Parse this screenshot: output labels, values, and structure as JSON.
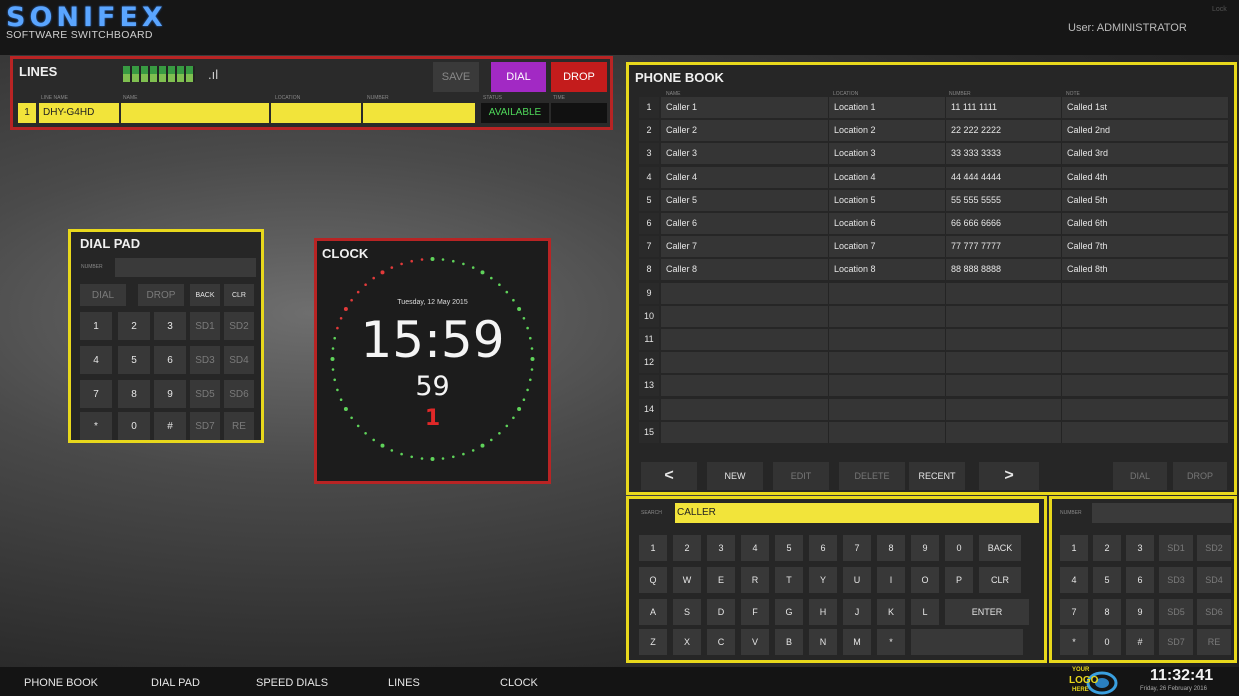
{
  "header": {
    "logo": "SONIFEX",
    "subtitle": "SOFTWARE SWITCHBOARD",
    "user": "User: ADMINISTRATOR",
    "user_tag": "Lock"
  },
  "lines": {
    "title": "LINES",
    "save_label": "SAVE",
    "dial_label": "DIAL",
    "drop_label": "DROP",
    "col_headers": [
      "LINE NAME",
      "NAME",
      "LOCATION",
      "NUMBER",
      "STATUS",
      "TIME"
    ],
    "row": {
      "index": "1",
      "name": "DHY-G4HD",
      "status": "AVAILABLE"
    }
  },
  "dialpad": {
    "title": "DIAL PAD",
    "number_label": "NUMBER",
    "top_keys": [
      "DIAL",
      "DROP",
      "BACK",
      "CLR"
    ],
    "keys": [
      [
        "1",
        "2",
        "3",
        "SD1",
        "SD2"
      ],
      [
        "4",
        "5",
        "6",
        "SD3",
        "SD4"
      ],
      [
        "7",
        "8",
        "9",
        "SD5",
        "SD6"
      ],
      [
        "*",
        "0",
        "#",
        "SD7",
        "RE"
      ]
    ]
  },
  "clock": {
    "title": "CLOCK",
    "date": "Tuesday, 12 May 2015",
    "time": "15:59",
    "seconds": "59",
    "red_digit": "1"
  },
  "phonebook": {
    "title": "PHONE BOOK",
    "col_headers": [
      "NAME",
      "LOCATION",
      "NUMBER",
      "NOTE"
    ],
    "rows": [
      {
        "idx": "1",
        "name": "Caller 1",
        "location": "Location 1",
        "number": "11 111 1111",
        "note": "Called 1st"
      },
      {
        "idx": "2",
        "name": "Caller 2",
        "location": "Location 2",
        "number": "22 222 2222",
        "note": "Called 2nd"
      },
      {
        "idx": "3",
        "name": "Caller 3",
        "location": "Location 3",
        "number": "33 333 3333",
        "note": "Called 3rd"
      },
      {
        "idx": "4",
        "name": "Caller 4",
        "location": "Location 4",
        "number": "44 444 4444",
        "note": "Called 4th"
      },
      {
        "idx": "5",
        "name": "Caller 5",
        "location": "Location 5",
        "number": "55 555 5555",
        "note": "Called 5th"
      },
      {
        "idx": "6",
        "name": "Caller 6",
        "location": "Location 6",
        "number": "66 666 6666",
        "note": "Called 6th"
      },
      {
        "idx": "7",
        "name": "Caller 7",
        "location": "Location 7",
        "number": "77 777 7777",
        "note": "Called 7th"
      },
      {
        "idx": "8",
        "name": "Caller 8",
        "location": "Location 8",
        "number": "88 888 8888",
        "note": "Called 8th"
      },
      {
        "idx": "9",
        "name": "",
        "location": "",
        "number": "",
        "note": ""
      },
      {
        "idx": "10",
        "name": "",
        "location": "",
        "number": "",
        "note": ""
      },
      {
        "idx": "11",
        "name": "",
        "location": "",
        "number": "",
        "note": ""
      },
      {
        "idx": "12",
        "name": "",
        "location": "",
        "number": "",
        "note": ""
      },
      {
        "idx": "13",
        "name": "",
        "location": "",
        "number": "",
        "note": ""
      },
      {
        "idx": "14",
        "name": "",
        "location": "",
        "number": "",
        "note": ""
      },
      {
        "idx": "15",
        "name": "",
        "location": "",
        "number": "",
        "note": ""
      }
    ],
    "buttons": {
      "prev": "<",
      "new": "NEW",
      "edit": "EDIT",
      "delete": "DELETE",
      "recent": "RECENT",
      "next": ">",
      "dial": "DIAL",
      "drop": "DROP"
    }
  },
  "keyboard": {
    "search_label": "SEARCH",
    "search_value": "CALLER",
    "rows": [
      [
        "1",
        "2",
        "3",
        "4",
        "5",
        "6",
        "7",
        "8",
        "9",
        "0",
        "BACK"
      ],
      [
        "Q",
        "W",
        "E",
        "R",
        "T",
        "Y",
        "U",
        "I",
        "O",
        "P",
        "CLR"
      ],
      [
        "A",
        "S",
        "D",
        "F",
        "G",
        "H",
        "J",
        "K",
        "L",
        "ENTER"
      ],
      [
        "Z",
        "X",
        "C",
        "V",
        "B",
        "N",
        "M",
        "*",
        ""
      ]
    ]
  },
  "speedpad": {
    "number_label": "NUMBER",
    "keys": [
      [
        "1",
        "2",
        "3",
        "SD1",
        "SD2"
      ],
      [
        "4",
        "5",
        "6",
        "SD3",
        "SD4"
      ],
      [
        "7",
        "8",
        "9",
        "SD5",
        "SD6"
      ],
      [
        "*",
        "0",
        "#",
        "SD7",
        "RE"
      ]
    ]
  },
  "bottom": {
    "nav": [
      "PHONE BOOK",
      "DIAL PAD",
      "SPEED DIALS",
      "LINES",
      "CLOCK"
    ],
    "logo_top": "YOUR",
    "logo_mid": "LOGO",
    "logo_bottom": "HERE",
    "time": "11:32:41",
    "date": "Friday, 26 February 2016"
  },
  "colors": {
    "accent_yellow": "#e8d81c",
    "accent_red": "#b82424",
    "dial_purple": "#a229c4",
    "drop_red": "#c41c1c",
    "logo_blue": "#5aa5ff"
  }
}
